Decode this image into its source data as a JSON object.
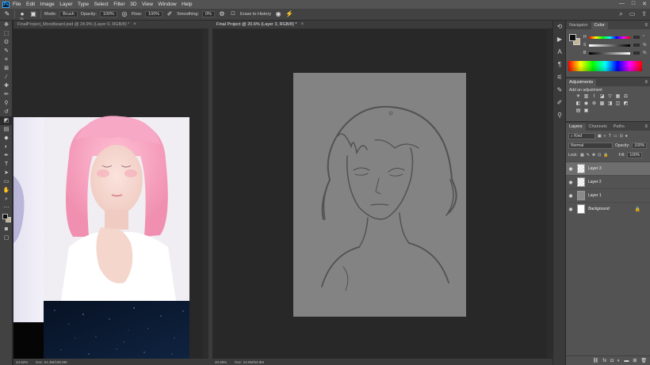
{
  "app": {
    "logo_text": "Ps"
  },
  "menu": [
    "File",
    "Edit",
    "Image",
    "Layer",
    "Type",
    "Select",
    "Filter",
    "3D",
    "View",
    "Window",
    "Help"
  ],
  "window_controls": [
    "—",
    "□",
    "✕"
  ],
  "options_bar": {
    "brush_size": "70",
    "mode_label": "Mode:",
    "mode_value": "Brush",
    "opacity_label": "Opacity:",
    "opacity_value": "100%",
    "flow_label": "Flow:",
    "flow_value": "100%",
    "smoothing_label": "Smoothing:",
    "smoothing_value": "0%",
    "erase_label": "Erase to History",
    "icons": [
      "eraser-icon",
      "brush-preset-icon",
      "toggle-brush-panel-icon",
      "pressure-opacity-icon",
      "airbrush-icon",
      "settings-gear-icon",
      "pressure-size-icon",
      "symmetry-icon"
    ]
  },
  "documents": [
    {
      "tab_title": "FinalProject_Moodboard.psd @ 24.9% (Layer 0, RGB/8) *",
      "close": "×",
      "zoom": "24.92%",
      "doc_size": "Doc: 61.3M/190.8M"
    },
    {
      "tab_title": "Final Project @ 20.6% (Layer 3, RGB/8) *",
      "close": "×",
      "zoom": "20.59%",
      "doc_size": "Doc: 24.9M/53.9M"
    }
  ],
  "color_panel": {
    "tabs": [
      "Navigator",
      "Color"
    ],
    "active_tab": "Color",
    "foreground": "#0f0f0f",
    "background": "#c5b592",
    "sliders": [
      {
        "letter": "H",
        "unit": "°"
      },
      {
        "letter": "S",
        "unit": "%"
      },
      {
        "letter": "B",
        "unit": "%"
      }
    ]
  },
  "adjustments": {
    "tab": "Adjustments",
    "hint": "Add an adjustment",
    "icons": [
      "brightness-contrast-icon",
      "levels-icon",
      "curves-icon",
      "exposure-icon",
      "vibrance-icon",
      "hue-saturation-icon",
      "color-balance-icon",
      "black-white-icon",
      "photo-filter-icon",
      "channel-mixer-icon",
      "color-lookup-icon",
      "invert-icon",
      "posterize-icon",
      "threshold-icon",
      "gradient-map-icon",
      "selective-color-icon"
    ]
  },
  "layers_panel": {
    "tabs": [
      "Layers",
      "Channels",
      "Paths"
    ],
    "active_tab": "Layers",
    "filter_value": "Kind",
    "blend_mode": "Normal",
    "opacity_label": "Opacity:",
    "opacity_value": "100%",
    "lock_label": "Lock:",
    "fill_label": "Fill:",
    "fill_value": "100%",
    "layers": [
      {
        "name": "Layer 3",
        "thumb": "checker",
        "selected": true,
        "italic": false,
        "locked": false
      },
      {
        "name": "Layer 2",
        "thumb": "checker",
        "selected": false,
        "italic": false,
        "locked": false
      },
      {
        "name": "Layer 1",
        "thumb": "gray",
        "selected": false,
        "italic": false,
        "locked": false
      },
      {
        "name": "Background",
        "thumb": "white",
        "selected": false,
        "italic": true,
        "locked": true
      }
    ],
    "bottom_icons": [
      "link-icon",
      "fx-icon",
      "mask-icon",
      "adjustment-layer-icon",
      "group-icon",
      "new-layer-icon",
      "trash-icon"
    ]
  }
}
